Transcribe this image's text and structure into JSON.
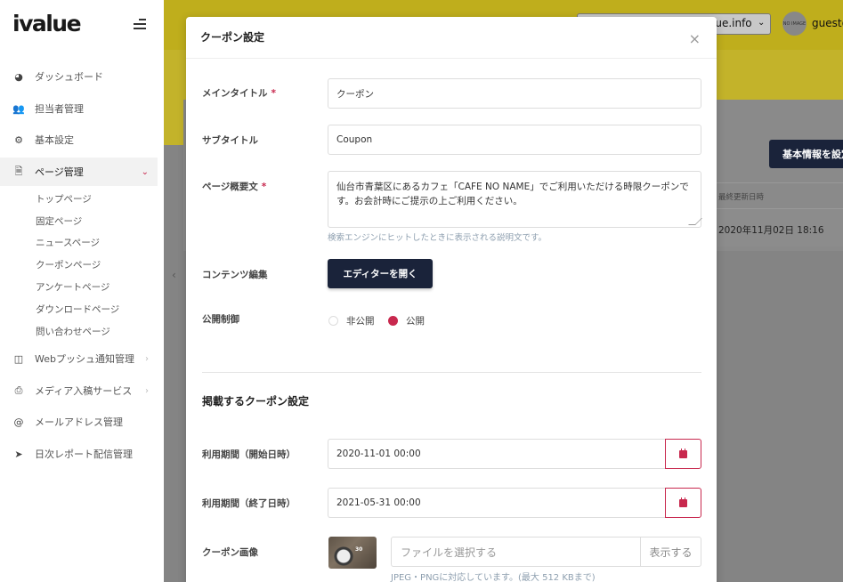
{
  "app": {
    "logo": "ivalue"
  },
  "header": {
    "domain_text": "lue.info",
    "user_text": "guest@",
    "avatar_label": "NO IMAGE"
  },
  "sidebar": {
    "items": [
      {
        "label": "ダッシュボード",
        "icon": "dashboard-icon"
      },
      {
        "label": "担当者管理",
        "icon": "users-icon"
      },
      {
        "label": "基本設定",
        "icon": "gear-icon"
      },
      {
        "label": "ページ管理",
        "icon": "document-icon",
        "active": true
      },
      {
        "label": "Webプッシュ通知管理",
        "icon": "columns-icon"
      },
      {
        "label": "メディア入稿サービス",
        "icon": "printer-icon"
      },
      {
        "label": "メールアドレス管理",
        "icon": "at-icon"
      },
      {
        "label": "日次レポート配信管理",
        "icon": "send-icon"
      }
    ],
    "sub_items": [
      "トップページ",
      "固定ページ",
      "ニュースページ",
      "クーポンページ",
      "アンケートページ",
      "ダウンロードページ",
      "問い合わせページ"
    ]
  },
  "background": {
    "button_label": "基本情報を設定",
    "table_header": "最終更新日時",
    "table_cell": "2020年11月02日 18:16"
  },
  "modal": {
    "title": "クーポン設定",
    "close_glyph": "×",
    "main_title": {
      "label": "メインタイトル",
      "required": "*",
      "value": "クーポン"
    },
    "subtitle": {
      "label": "サブタイトル",
      "value": "Coupon"
    },
    "summary": {
      "label": "ページ概要文",
      "required": "*",
      "value": "仙台市青葉区にあるカフェ「CAFE NO NAME」でご利用いただける時限クーポンです。お会計時にご提示の上ご利用ください。",
      "help": "検索エンジンにヒットしたときに表示される説明文です。"
    },
    "content": {
      "label": "コンテンツ編集",
      "button": "エディターを開く"
    },
    "publish": {
      "label": "公開制御",
      "options": [
        "非公開",
        "公開"
      ],
      "selected": "公開"
    },
    "coupon_section_title": "掲載するクーポン設定",
    "start": {
      "label": "利用期間（開始日時）",
      "value": "2020-11-01 00:00"
    },
    "end": {
      "label": "利用期間（終了日時）",
      "value": "2021-05-31 00:00"
    },
    "image": {
      "label": "クーポン画像",
      "thumb_text": "30",
      "file_placeholder": "ファイルを選択する",
      "browse_button": "表示する",
      "help": "JPEG・PNGに対応しています。(最大 512 KBまで)"
    }
  },
  "colors": {
    "accent": "#c8284e",
    "navy": "#1a233a",
    "brand_yellow": "#e6d21e"
  }
}
